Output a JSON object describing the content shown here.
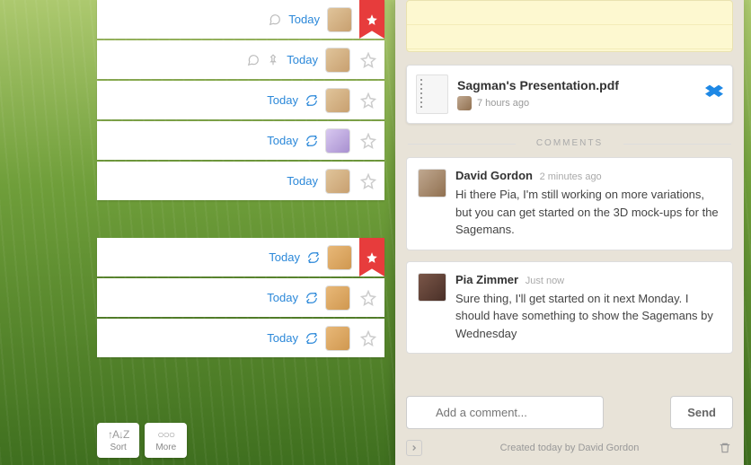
{
  "tasks": [
    {
      "date": "Today",
      "chat": true,
      "pin": false,
      "recur": false,
      "avatar": "m1",
      "starred": true
    },
    {
      "date": "Today",
      "chat": true,
      "pin": true,
      "recur": false,
      "avatar": "m1",
      "starred": false
    },
    {
      "date": "Today",
      "chat": false,
      "pin": false,
      "recur": true,
      "avatar": "m1",
      "starred": false
    },
    {
      "date": "Today",
      "chat": false,
      "pin": false,
      "recur": true,
      "avatar": "m2",
      "starred": false
    },
    {
      "date": "Today",
      "chat": false,
      "pin": false,
      "recur": false,
      "avatar": "m1",
      "starred": false
    }
  ],
  "tasks2": [
    {
      "date": "Today",
      "recur": true,
      "avatar": "f1",
      "starred": true
    },
    {
      "date": "Today",
      "recur": true,
      "avatar": "f1",
      "starred": false
    },
    {
      "date": "Today",
      "recur": true,
      "avatar": "f1",
      "starred": false
    }
  ],
  "toolbar": {
    "sort": {
      "icon": "↑A↓Z",
      "label": "Sort"
    },
    "more": {
      "icon": "○○○",
      "label": "More"
    }
  },
  "file": {
    "title": "Sagman's Presentation.pdf",
    "time": "7 hours ago"
  },
  "comments_label": "COMMENTS",
  "comments": [
    {
      "author": "David Gordon",
      "time": "2 minutes ago",
      "body": "Hi there Pia, I'm still working on more variations, but you can get started on the 3D mock-ups for the Sagemans.",
      "avatar": "m3"
    },
    {
      "author": "Pia Zimmer",
      "time": "Just now",
      "body": "Sure thing, I'll get started on it next Monday. I should have something to show the Sagemans by Wednesday",
      "avatar": "f2"
    }
  ],
  "compose": {
    "placeholder": "Add a comment...",
    "send": "Send"
  },
  "footer": {
    "created": "Created today by David Gordon"
  }
}
